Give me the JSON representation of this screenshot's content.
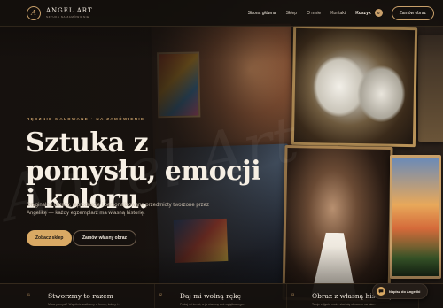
{
  "brand": {
    "mark": "A",
    "title": "ANGEL ART",
    "subtitle": "sztuka na zamówienie"
  },
  "nav": {
    "items": [
      {
        "label": "Strona główna",
        "active": true
      },
      {
        "label": "Sklep",
        "active": false
      },
      {
        "label": "O mnie",
        "active": false
      },
      {
        "label": "Kontakt",
        "active": false
      }
    ],
    "cart_label": "Koszyk",
    "cart_count": "0",
    "order_button": "Zamów obraz"
  },
  "hero": {
    "eyebrow": "Ręcznie malowane • na zamówienie",
    "title": "Sztuka z pomysłu, emocji i koloru.",
    "description": "Oryginalne obrazy, reprodukcje i personalizowane przedmioty tworzone przez Angelikę — każdy egzemplarz ma własną historię.",
    "primary_button": "Zobacz sklep",
    "secondary_button": "Zamów własny obraz",
    "watermark": "Angel Art"
  },
  "features": [
    {
      "num": "01",
      "title": "Stworzmy to razem",
      "text": "Masz pomysł? Wspólnie zadbamy o formę, kolory i..."
    },
    {
      "num": "02",
      "title": "Daj mi wolną rękę",
      "text": "Podaj mi temat, a ja stworzę coś wyjątkowego..."
    },
    {
      "num": "03",
      "title": "Obraz z własną historią",
      "text": "Twoje zdjęcie może stać się obrazem na lata..."
    }
  ],
  "chat": {
    "label": "Napisz do Angeliki",
    "icon": "chat-bubble-icon"
  },
  "colors": {
    "accent": "#c9a06a",
    "primary_button_bg": "#d9a964",
    "background": "#1a1512"
  }
}
